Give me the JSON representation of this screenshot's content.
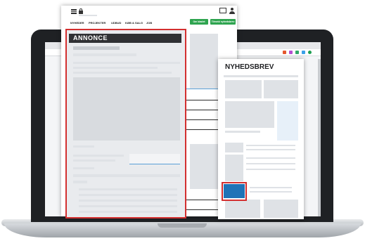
{
  "site": {
    "nav_items": [
      "NYHEDER",
      "PROJEKTER",
      "UDBUD",
      "KØB & SALG",
      "JOB"
    ],
    "buttons": [
      "Om bladet",
      "Tilmeld nyhedsbrev"
    ]
  },
  "ad": {
    "label": "ANNONCE"
  },
  "newsletter": {
    "title": "NYHEDSBREV"
  },
  "colors": {
    "highlight_red": "#d32f2f",
    "cta_blue": "#1f73b7",
    "nav_green": "#2ea44f",
    "ad_header_dark": "#303134"
  },
  "icons": [
    "menu-icon",
    "lock-icon",
    "mail-icon",
    "user-icon"
  ]
}
